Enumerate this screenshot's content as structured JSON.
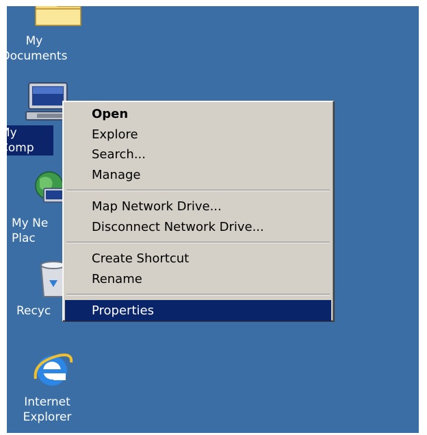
{
  "desktop": {
    "background_color": "#3a6ea5",
    "icons": [
      {
        "label": "My Documents",
        "icon": "folder-icon"
      },
      {
        "label": "My Comp",
        "icon": "my-computer-icon",
        "selected": true
      },
      {
        "label": "My Ne\nPlac",
        "icon": "network-places-icon"
      },
      {
        "label": "Recyc",
        "icon": "recycle-bin-icon"
      },
      {
        "label": "Internet\nExplorer",
        "icon": "internet-explorer-icon"
      }
    ]
  },
  "context_menu": {
    "items": [
      {
        "label": "Open",
        "bold": true
      },
      {
        "label": "Explore"
      },
      {
        "label": "Search..."
      },
      {
        "label": "Manage"
      },
      {
        "label": "Map Network Drive..."
      },
      {
        "label": "Disconnect Network Drive..."
      },
      {
        "label": "Create Shortcut"
      },
      {
        "label": "Rename"
      },
      {
        "label": "Properties",
        "highlighted": true
      }
    ],
    "highlight_color": "#0a246a",
    "background_color": "#d4d0c8"
  }
}
